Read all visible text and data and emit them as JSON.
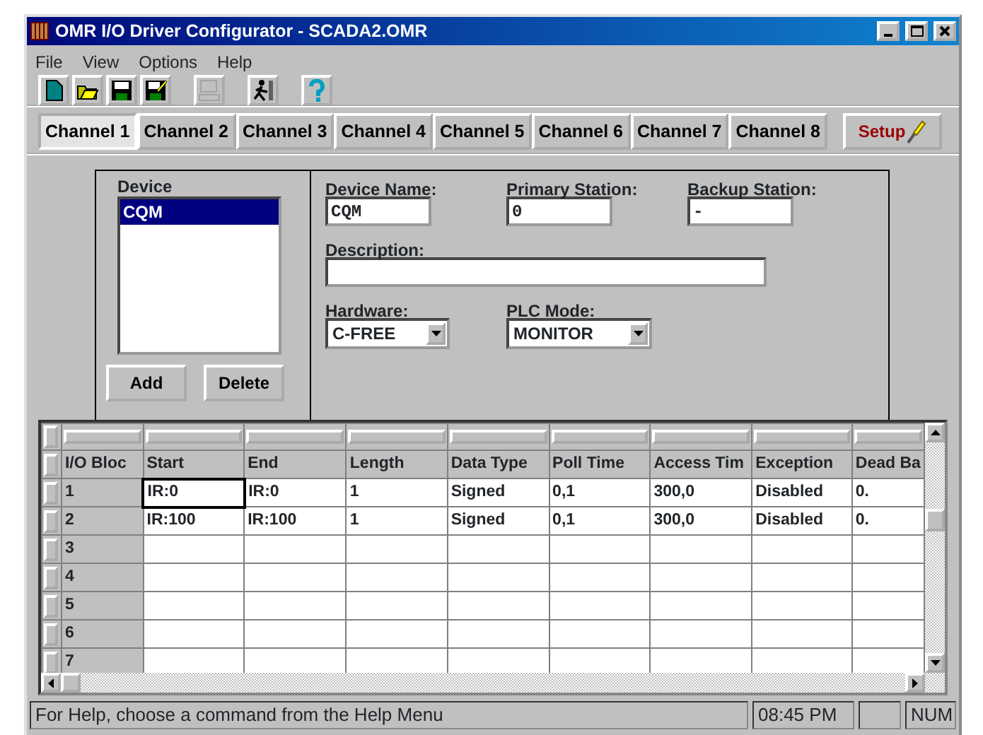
{
  "window": {
    "title": "OMR I/O Driver Configurator - SCADA2.OMR"
  },
  "menu": [
    "File",
    "View",
    "Options",
    "Help"
  ],
  "toolbar": [
    {
      "kind": "new",
      "disabled": false
    },
    {
      "kind": "open",
      "disabled": false
    },
    {
      "kind": "save",
      "disabled": false
    },
    {
      "kind": "save-as",
      "disabled": false
    },
    {
      "kind": "print",
      "disabled": true
    },
    {
      "kind": "run",
      "disabled": false
    },
    {
      "kind": "help",
      "disabled": false
    }
  ],
  "tabs": [
    {
      "label": "Channel 1",
      "selected": true
    },
    {
      "label": "Channel 2",
      "selected": false
    },
    {
      "label": "Channel 3",
      "selected": false
    },
    {
      "label": "Channel 4",
      "selected": false
    },
    {
      "label": "Channel 5",
      "selected": false
    },
    {
      "label": "Channel 6",
      "selected": false
    },
    {
      "label": "Channel 7",
      "selected": false
    },
    {
      "label": "Channel 8",
      "selected": false
    }
  ],
  "setup_button": {
    "label": "Setup"
  },
  "device": {
    "title": "Device",
    "items": [
      {
        "label": "CQM",
        "selected": true
      }
    ],
    "buttons": [
      "Add",
      "Delete"
    ]
  },
  "fields": {
    "device_name": {
      "label": "Device Name:",
      "value": "CQM"
    },
    "primary_station": {
      "label": "Primary Station:",
      "value": "0"
    },
    "backup_station": {
      "label": "Backup Station:",
      "value": "-"
    },
    "description": {
      "label": "Description:"
    },
    "hardware": {
      "label": "Hardware:",
      "value": "C-FREE"
    },
    "plc_mode": {
      "label": "PLC Mode:",
      "value": "MONITOR"
    }
  },
  "table": {
    "columns": [
      "I/O Bloc",
      "Start",
      "End",
      "Length",
      "Data Type",
      "Poll Time",
      "Access Tim",
      "Exception",
      "Dead Ba"
    ],
    "rows": [
      {
        "label": "1",
        "cells": [
          {
            "text": "IR:0",
            "focused": true
          },
          {
            "text": "IR:0",
            "focused": false
          },
          {
            "text": "1",
            "focused": false
          },
          {
            "text": "Signed",
            "focused": false
          },
          {
            "text": "0,1",
            "focused": false
          },
          {
            "text": "300,0",
            "focused": false
          },
          {
            "text": "Disabled",
            "focused": false
          },
          {
            "text": "0.",
            "focused": false
          }
        ]
      },
      {
        "label": "2",
        "cells": [
          {
            "text": "IR:100",
            "focused": false
          },
          {
            "text": "IR:100",
            "focused": false
          },
          {
            "text": "1",
            "focused": false
          },
          {
            "text": "Signed",
            "focused": false
          },
          {
            "text": "0,1",
            "focused": false
          },
          {
            "text": "300,0",
            "focused": false
          },
          {
            "text": "Disabled",
            "focused": false
          },
          {
            "text": "0.",
            "focused": false
          }
        ]
      },
      {
        "label": "3"
      },
      {
        "label": "4"
      },
      {
        "label": "5"
      },
      {
        "label": "6"
      },
      {
        "label": "7"
      }
    ]
  },
  "status_bar": {
    "message": "For Help, choose a command from the Help Menu",
    "time": "08:45 PM",
    "num": "NUM"
  }
}
